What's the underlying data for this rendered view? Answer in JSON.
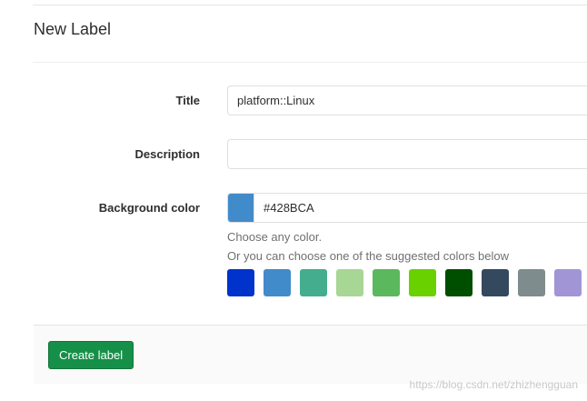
{
  "header": {
    "title": "New Label"
  },
  "form": {
    "title_label": "Title",
    "title_value": "platform::Linux",
    "description_label": "Description",
    "description_value": "",
    "bg_label": "Background color",
    "bg_value": "#428BCA",
    "help_line1": "Choose any color.",
    "help_line2": "Or you can choose one of the suggested colors below"
  },
  "suggested_colors": [
    "#0033CC",
    "#428BCA",
    "#44AD8E",
    "#A8D695",
    "#5CB85C",
    "#69D100",
    "#004E00",
    "#34495E",
    "#7F8C8D",
    "#A295D6"
  ],
  "actions": {
    "create_label": "Create label"
  },
  "watermark": "https://blog.csdn.net/zhizhengguan"
}
